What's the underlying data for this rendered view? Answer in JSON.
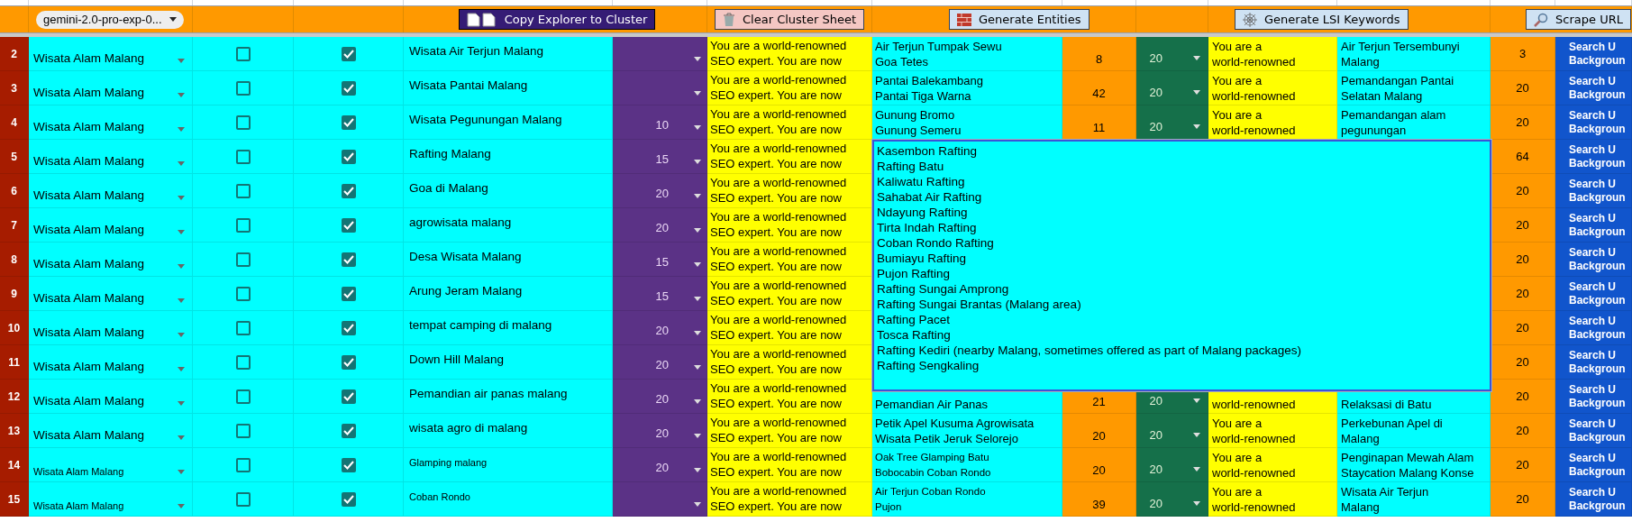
{
  "toolbar": {
    "model_select": "gemini-2.0-pro-exp-0...",
    "buttons": [
      {
        "label": "Copy Explorer to Cluster",
        "kind": "copy"
      },
      {
        "label": "Clear Cluster Sheet",
        "kind": "clear"
      },
      {
        "label": "Generate Entities",
        "kind": "entities"
      },
      {
        "label": "Generate LSI Keywords",
        "kind": "lsi"
      },
      {
        "label": "Scrape URL",
        "kind": "scrape"
      }
    ]
  },
  "rows": [
    {
      "number": "2",
      "category": "Wisata Alam Malang",
      "small_text": false,
      "selected_b": false,
      "checked": true,
      "keyword": "Wisata Air Terjun Malang",
      "count": "",
      "prompt": [
        "You are a world-renowned",
        "SEO expert. You are now"
      ],
      "entities": [
        "Air Terjun Tumpak Sewu",
        "Goa Tetes"
      ],
      "entity_count": "8",
      "limit": "20",
      "lsi_prompt": [
        "You are a",
        "world-renowned"
      ],
      "lsi": [
        "Air Terjun Tersembunyi",
        "Malang"
      ],
      "lsi_count": "3",
      "action": [
        "Search U",
        "Backgroun"
      ]
    },
    {
      "number": "3",
      "category": "Wisata Alam Malang",
      "small_text": false,
      "selected_b": false,
      "checked": true,
      "keyword": "Wisata Pantai Malang",
      "count": "",
      "prompt": [
        "You are a world-renowned",
        "SEO expert. You are now"
      ],
      "entities": [
        "Pantai Balekambang",
        "Pantai Tiga Warna"
      ],
      "entity_count": "42",
      "limit": "20",
      "lsi_prompt": [
        "You are a",
        "world-renowned"
      ],
      "lsi": [
        "Pemandangan Pantai",
        "Selatan Malang"
      ],
      "lsi_count": "20",
      "action": [
        "Search U",
        "Backgroun"
      ]
    },
    {
      "number": "4",
      "category": "Wisata Alam Malang",
      "small_text": false,
      "selected_b": false,
      "checked": true,
      "keyword": "Wisata Pegunungan Malang",
      "count": "10",
      "prompt": [
        "You are a world-renowned",
        "SEO expert. You are now"
      ],
      "entities": [
        "Gunung Bromo",
        "Gunung Semeru"
      ],
      "entity_count": "11",
      "limit": "20",
      "lsi_prompt": [
        "You are a",
        "world-renowned"
      ],
      "lsi": [
        "Pemandangan alam",
        "pegunungan"
      ],
      "lsi_count": "20",
      "action": [
        "Search U",
        "Backgroun"
      ]
    },
    {
      "number": "5",
      "category": "Wisata Alam Malang",
      "small_text": false,
      "selected_b": false,
      "checked": true,
      "keyword": "Rafting Malang",
      "count": "15",
      "prompt": [
        "You are a world-renowned",
        "SEO expert. You are now"
      ],
      "lsi_count": "64",
      "action": [
        "Search U",
        "Backgroun"
      ]
    },
    {
      "number": "6",
      "category": "Wisata Alam Malang",
      "small_text": false,
      "selected_b": false,
      "checked": true,
      "keyword": "Goa di Malang",
      "count": "20",
      "prompt": [
        "You are a world-renowned",
        "SEO expert. You are now"
      ],
      "lsi_count": "20",
      "action": [
        "Search U",
        "Backgroun"
      ]
    },
    {
      "number": "7",
      "category": "Wisata Alam Malang",
      "small_text": false,
      "selected_b": false,
      "checked": true,
      "keyword": "agrowisata malang",
      "count": "20",
      "prompt": [
        "You are a world-renowned",
        "SEO expert. You are now"
      ],
      "lsi_count": "20",
      "action": [
        "Search U",
        "Backgroun"
      ]
    },
    {
      "number": "8",
      "category": "Wisata Alam Malang",
      "small_text": false,
      "selected_b": false,
      "checked": true,
      "keyword": "Desa Wisata Malang",
      "count": "15",
      "prompt": [
        "You are a world-renowned",
        "SEO expert. You are now"
      ],
      "lsi_count": "20",
      "action": [
        "Search U",
        "Backgroun"
      ]
    },
    {
      "number": "9",
      "category": "Wisata Alam Malang",
      "small_text": false,
      "selected_b": false,
      "checked": true,
      "keyword": "Arung Jeram Malang",
      "count": "15",
      "prompt": [
        "You are a world-renowned",
        "SEO expert. You are now"
      ],
      "lsi_count": "20",
      "action": [
        "Search U",
        "Backgroun"
      ]
    },
    {
      "number": "10",
      "category": "Wisata Alam Malang",
      "small_text": false,
      "selected_b": false,
      "checked": true,
      "keyword": "tempat camping di malang",
      "count": "20",
      "prompt": [
        "You are a world-renowned",
        "SEO expert. You are now"
      ],
      "lsi_count": "20",
      "action": [
        "Search U",
        "Backgroun"
      ]
    },
    {
      "number": "11",
      "category": "Wisata Alam Malang",
      "small_text": false,
      "selected_b": false,
      "checked": true,
      "keyword": "Down Hill Malang",
      "count": "20",
      "prompt": [
        "You are a world-renowned",
        "SEO expert. You are now"
      ],
      "lsi_count": "20",
      "action": [
        "Search U",
        "Backgroun"
      ]
    },
    {
      "number": "12",
      "category": "Wisata Alam Malang",
      "small_text": false,
      "selected_b": false,
      "checked": true,
      "keyword": "Pemandian air panas malang",
      "count": "20",
      "prompt": [
        "You are a world-renowned",
        "SEO expert. You are now"
      ],
      "entities": [
        "Pemandian Air Panas"
      ],
      "entity_count": "21",
      "limit": "20",
      "lsi_prompt": [
        "world-renowned"
      ],
      "lsi": [
        "Relaksasi di Batu"
      ],
      "lsi_count": "20",
      "action": [
        "Search U",
        "Backgroun"
      ]
    },
    {
      "number": "13",
      "category": "Wisata Alam Malang",
      "small_text": false,
      "selected_b": false,
      "checked": true,
      "keyword": "wisata agro di malang",
      "count": "20",
      "prompt": [
        "You are a world-renowned",
        "SEO expert. You are now"
      ],
      "entities": [
        "Petik Apel Kusuma Agrowisata",
        "Wisata Petik Jeruk Selorejo"
      ],
      "entity_count": "20",
      "limit": "20",
      "lsi_prompt": [
        "You are a",
        "world-renowned"
      ],
      "lsi": [
        "Perkebunan Apel di",
        "Malang"
      ],
      "lsi_count": "20",
      "action": [
        "Search U",
        "Backgroun"
      ]
    },
    {
      "number": "14",
      "category": "Wisata Alam Malang",
      "small_text": true,
      "selected_b": false,
      "checked": true,
      "keyword": "Glamping malang",
      "count": "20",
      "prompt": [
        "You are a world-renowned",
        "SEO expert. You are now"
      ],
      "entities": [
        "Oak Tree Glamping Batu",
        "Bobocabin Coban Rondo"
      ],
      "entity_count": "20",
      "limit": "20",
      "lsi_prompt": [
        "You are a",
        "world-renowned"
      ],
      "lsi": [
        "Penginapan Mewah Alam",
        "Staycation Malang Konse"
      ],
      "lsi_count": "20",
      "action": [
        "Search U",
        "Backgroun"
      ]
    },
    {
      "number": "15",
      "category": "Wisata Alam Malang",
      "small_text": true,
      "selected_b": false,
      "checked": true,
      "keyword": "Coban Rondo",
      "count": "",
      "prompt": [
        "You are a world-renowned",
        "SEO expert. You are now"
      ],
      "entities": [
        "Air Terjun Coban Rondo",
        "Pujon"
      ],
      "entity_count": "39",
      "limit": "20",
      "lsi_prompt": [
        "You are a",
        "world-renowned"
      ],
      "lsi": [
        "Wisata Air Terjun",
        "Malang"
      ],
      "lsi_count": "20",
      "action": [
        "Search U",
        "Backgroun"
      ]
    }
  ],
  "expanded_cell": {
    "lines": [
      "Kasembon Rafting",
      "Rafting Batu",
      "Kaliwatu Rafting",
      "Sahabat Air Rafting",
      "Ndayung Rafting",
      "Tirta Indah Rafting",
      "Coban Rondo Rafting",
      "Bumiayu Rafting",
      "Pujon Rafting",
      "Rafting Sungai Amprong",
      "Rafting Sungai Brantas (Malang area)",
      "Rafting Pacet",
      "Tosca Rafting",
      "Rafting Kediri (nearby Malang, sometimes offered as part of Malang packages)",
      "Rafting Sengkaling"
    ]
  }
}
